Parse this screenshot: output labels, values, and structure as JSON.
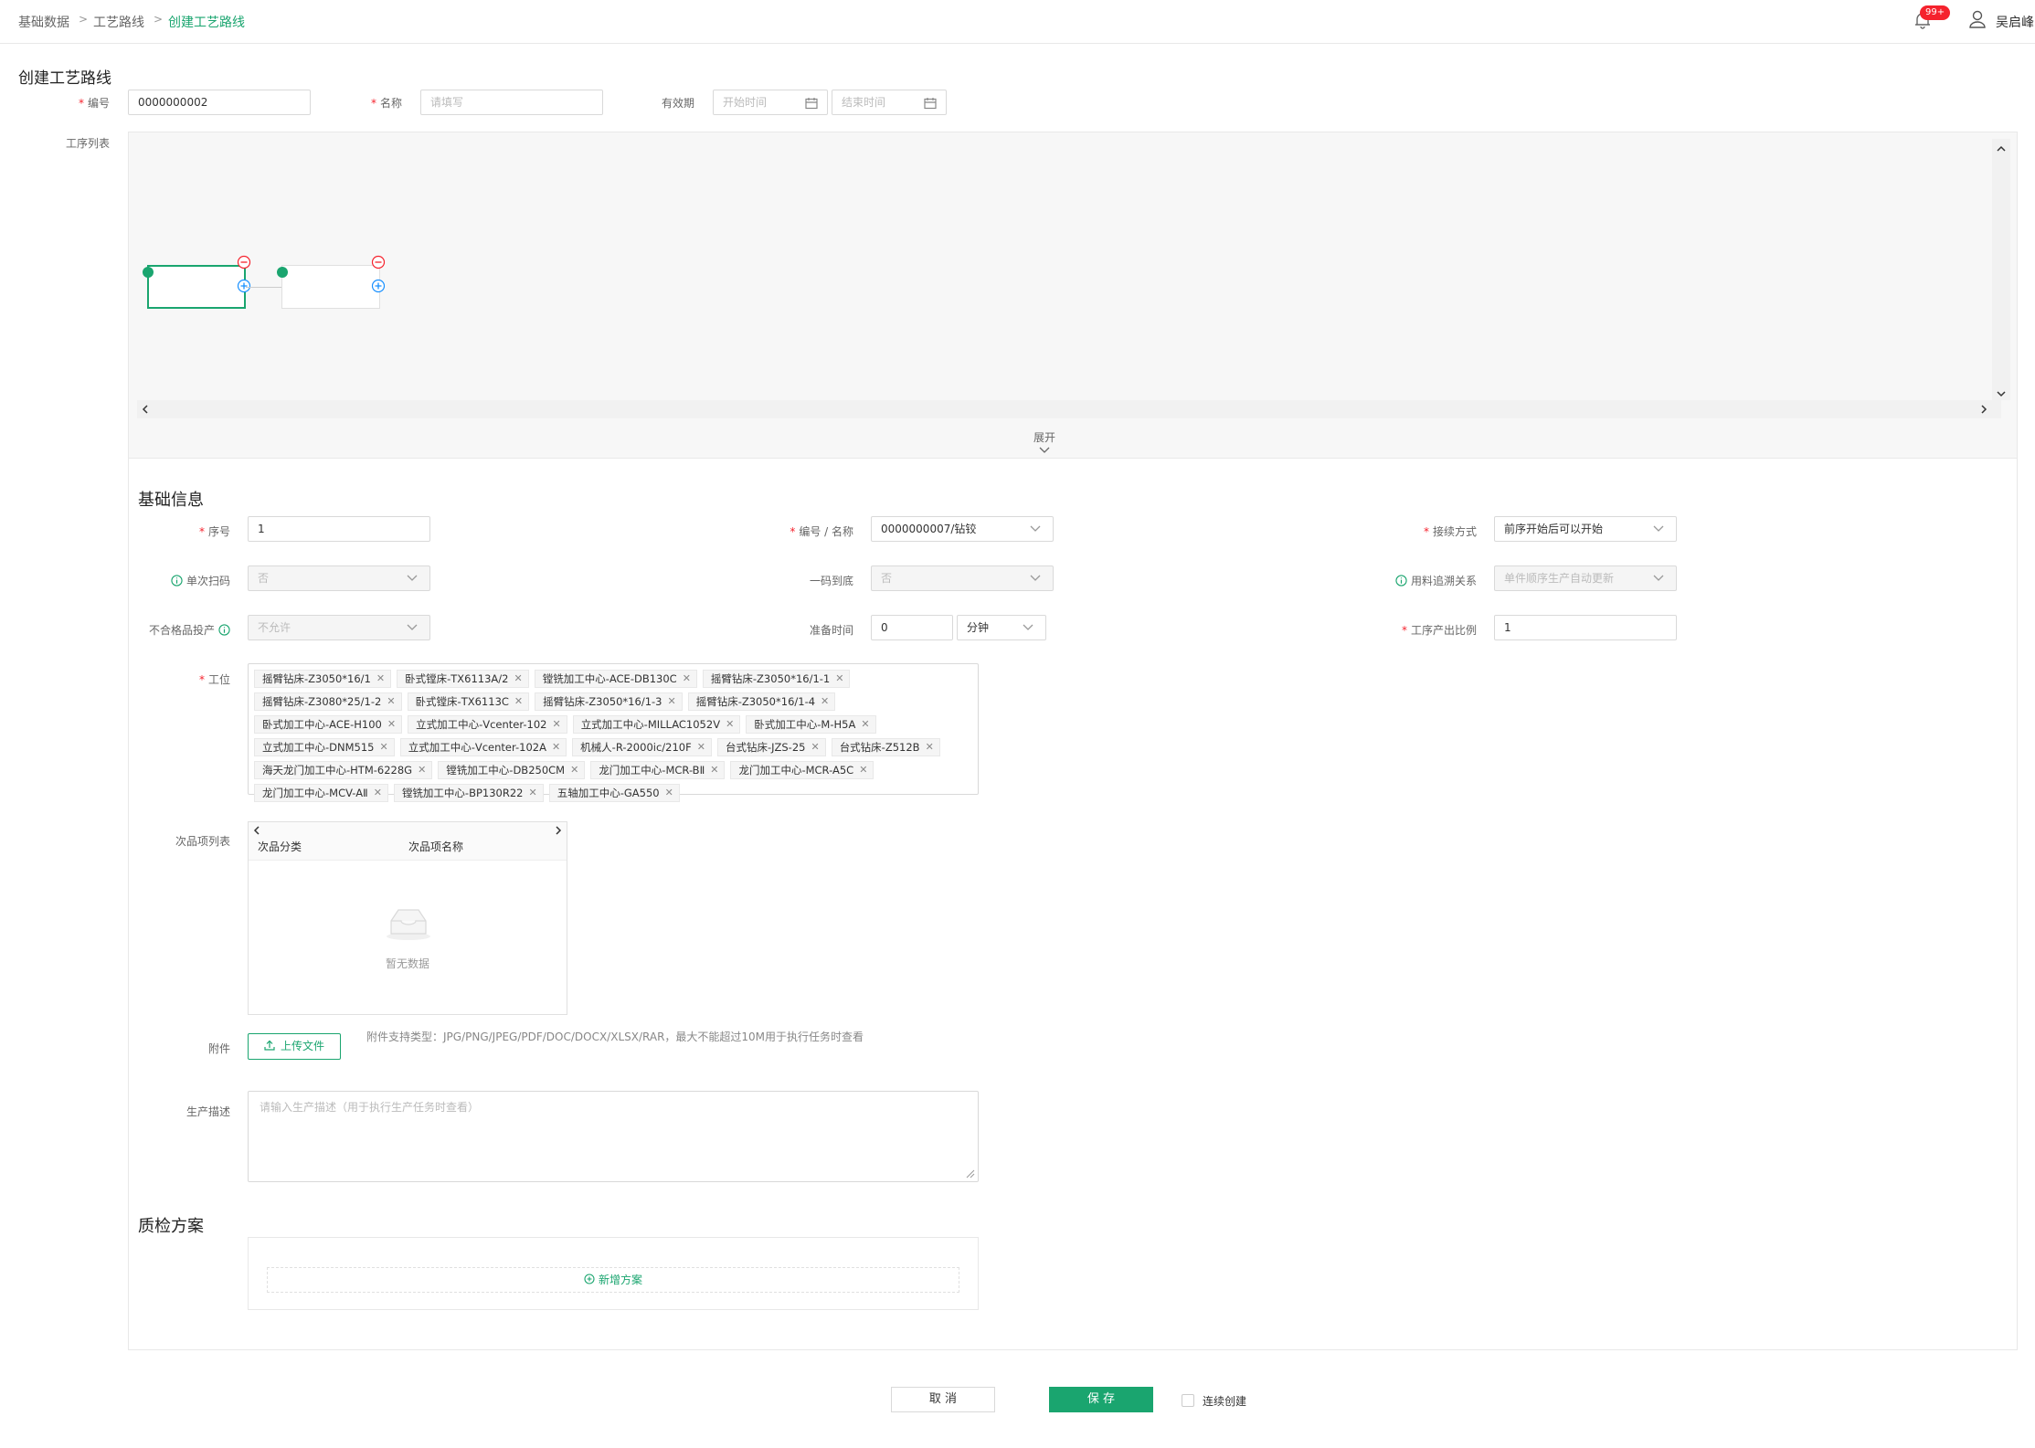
{
  "breadcrumb": [
    "基础数据",
    "工艺路线",
    "创建工艺路线"
  ],
  "breadcrumb_sep": ">",
  "header": {
    "badge": "99+",
    "username": "吴启峰"
  },
  "page_title": "创建工艺路线",
  "top_form": {
    "code_label": "编号",
    "code_value": "0000000002",
    "name_label": "名称",
    "name_placeholder": "请填写",
    "validity_label": "有效期",
    "start_placeholder": "开始时间",
    "end_placeholder": "结束时间"
  },
  "process_list_label": "工序列表",
  "expand_label": "展开",
  "basic": {
    "title": "基础信息",
    "seq_label": "序号",
    "seq_value": "1",
    "code_name_label": "编号 / 名称",
    "code_name_value": "0000000007/钻铰",
    "connect_label": "接续方式",
    "connect_value": "前序开始后可以开始",
    "scan_label": "单次扫码",
    "scan_value": "否",
    "code_to_end_label": "一码到底",
    "code_to_end_value": "否",
    "trace_label": "用料追溯关系",
    "trace_value": "单件顺序生产自动更新",
    "defect_label": "不合格品投产",
    "defect_value": "不允许",
    "prep_label": "准备时间",
    "prep_value": "0",
    "prep_unit": "分钟",
    "ratio_label": "工序产出比例",
    "ratio_value": "1",
    "station_label": "工位",
    "stations": [
      "摇臂钻床-Z3050*16/1",
      "卧式镗床-TX6113A/2",
      "镗铣加工中心-ACE-DB130C",
      "摇臂钻床-Z3050*16/1-1",
      "摇臂钻床-Z3080*25/1-2",
      "卧式镗床-TX6113C",
      "摇臂钻床-Z3050*16/1-3",
      "摇臂钻床-Z3050*16/1-4",
      "卧式加工中心-ACE-H100",
      "立式加工中心-Vcenter-102",
      "立式加工中心-MILLAC1052V",
      "卧式加工中心-M-H5A",
      "立式加工中心-DNM515",
      "立式加工中心-Vcenter-102A",
      "机械人-R-2000ic/210F",
      "台式钻床-JZS-25",
      "台式钻床-Z512B",
      "海天龙门加工中心-HTM-6228G",
      "镗铣加工中心-DB250CM",
      "龙门加工中心-MCR-BⅡ",
      "龙门加工中心-MCR-A5C",
      "龙门加工中心-MCV-AⅡ",
      "镗铣加工中心-BP130R22",
      "五轴加工中心-GA550"
    ],
    "defect_list_label": "次品项列表",
    "defect_cols": [
      "次品分类",
      "次品项名称"
    ],
    "empty_text": "暂无数据",
    "attach_label": "附件",
    "upload_label": "上传文件",
    "attach_hint": "附件支持类型：JPG/PNG/JPEG/PDF/DOC/DOCX/XLSX/RAR，最大不能超过10M用于执行任务时查看",
    "desc_label": "生产描述",
    "desc_placeholder": "请输入生产描述（用于执行生产任务时查看）"
  },
  "qc": {
    "title": "质检方案",
    "add_label": "新增方案"
  },
  "footer": {
    "cancel": "取 消",
    "save": "保 存",
    "continue": "连续创建"
  },
  "colors": {
    "accent": "#1aa56f",
    "required": "#f5222d"
  }
}
